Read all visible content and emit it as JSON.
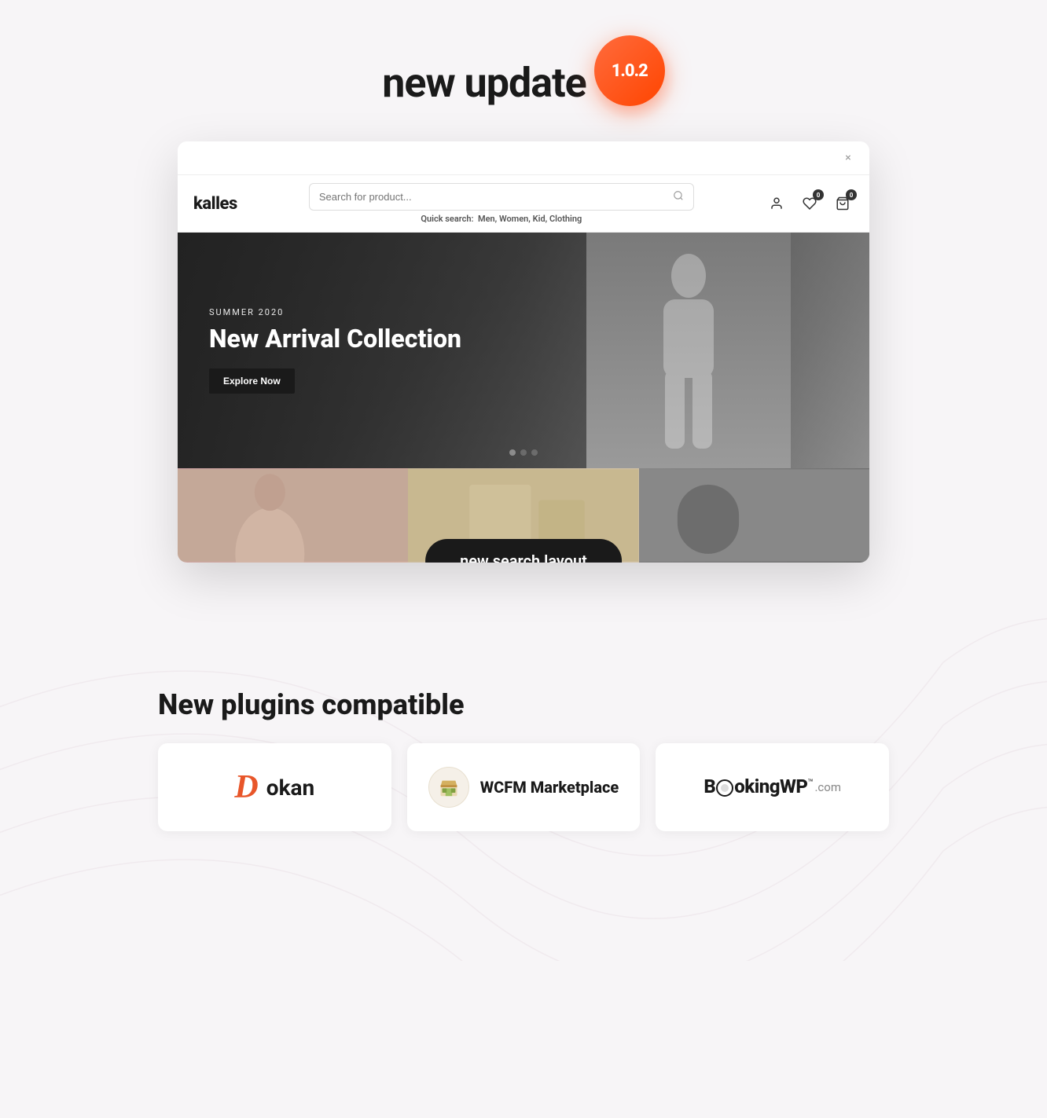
{
  "header": {
    "title": "new update",
    "version": "1.0.2"
  },
  "store": {
    "logo": "kalles",
    "search": {
      "placeholder": "Search for product...",
      "quick_search_label": "Quick search:",
      "quick_search_items": "Men, Women, Kid, Clothing"
    },
    "actions": {
      "wishlist_count": "0",
      "cart_count": "0"
    },
    "hero": {
      "season": "SUMMER 2020",
      "title": "New Arrival Collection",
      "cta": "Explore Now"
    },
    "slider_dots": [
      "active",
      "",
      ""
    ]
  },
  "search_layout_label": "new search layout",
  "plugins": {
    "section_title": "New plugins compatible",
    "items": [
      {
        "name": "Dokan",
        "logo_type": "dokan"
      },
      {
        "name": "WCFM Marketplace",
        "logo_type": "wcfm"
      },
      {
        "name": "BookingWP",
        "logo_type": "bookingwp"
      }
    ]
  },
  "close_button": "×"
}
